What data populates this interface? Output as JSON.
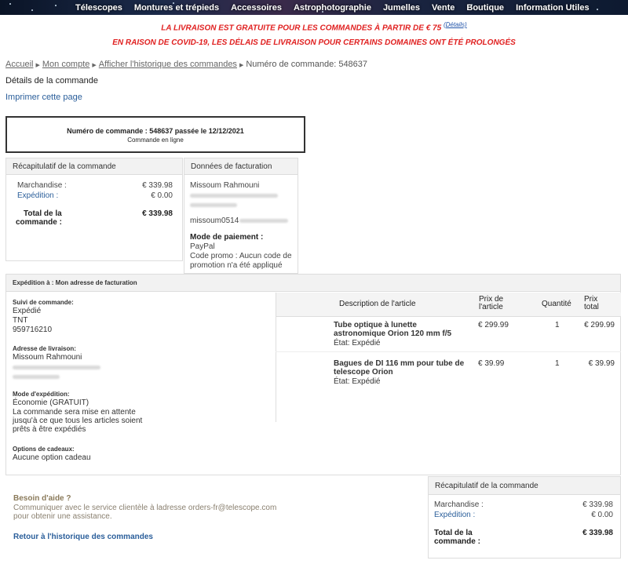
{
  "nav": {
    "items": [
      "Télescopes",
      "Montures et trépieds",
      "Accessoires",
      "Astrophotographie",
      "Jumelles",
      "Vente",
      "Boutique",
      "Information Utiles"
    ]
  },
  "promo": {
    "line1": "LA LIVRAISON EST GRATUITE POUR LES COMMANDES À PARTIR DE € 75",
    "line1_link": "(Détails)",
    "line2": "EN RAISON DE COVID-19, LES DÉLAIS DE LIVRAISON POUR CERTAINS DOMAINES ONT ÉTÉ PROLONGÉS"
  },
  "breadcrumb": {
    "home": "Accueil",
    "account": "Mon compte",
    "history": "Afficher l'historique des commandes",
    "current": "Numéro de commande: 548637"
  },
  "page": {
    "title": "Détails de la commande",
    "print": "Imprimer cette page"
  },
  "order": {
    "header": "Numéro de commande : 548637 passée le 12/12/2021",
    "type": "Commande en ligne"
  },
  "recap": {
    "title": "Récapitulatif de la commande",
    "merch_label": "Marchandise :",
    "merch_value": "€ 339.98",
    "ship_label": "Expédition :",
    "ship_value": "€ 0.00",
    "total_label_1": "Total de la",
    "total_label_2": "commande :",
    "total_value": "€ 339.98"
  },
  "billing": {
    "title": "Données de facturation",
    "name": "Missoum Rahmouni",
    "email_prefix": "missoum0514",
    "payment_title": "Mode de paiement :",
    "payment_method": "PayPal",
    "promo_line1": "Code promo :  Aucun code de",
    "promo_line2": "promotion n'a été appliqué"
  },
  "shipping": {
    "title": "Expédition à : Mon adresse de facturation",
    "tracking_label": "Suivi de commande:",
    "tracking_status": "Expédié",
    "carrier": "TNT",
    "tracking_number": "959716210",
    "address_label": "Adresse de livraison:",
    "address_name": "Missoum Rahmouni",
    "method_label": "Mode d'expédition:",
    "method_value": "Économie (GRATUIT)",
    "method_note_1": "La commande sera mise en attente",
    "method_note_2": "jusqu'à ce que tous les articles soient",
    "method_note_3": "prêts à être expédiés",
    "gift_label": "Options de cadeaux:",
    "gift_value": "Aucune option cadeau"
  },
  "items": {
    "head_desc": "Description de l'article",
    "head_price_1": "Prix de",
    "head_price_2": "l'article",
    "head_qty": "Quantité",
    "head_total_1": "Prix",
    "head_total_2": "total",
    "rows": [
      {
        "name_1": "Tube optique à lunette",
        "name_2": "astronomique Orion 120 mm f/5",
        "status": "État: Expédié",
        "price": "€ 299.99",
        "qty": "1",
        "total": "€ 299.99"
      },
      {
        "name_1": "Bagues de DI 116 mm pour tube de",
        "name_2": "telescope Orion",
        "status": "État: Expédié",
        "price": "€ 39.99",
        "qty": "1",
        "total": "€ 39.99"
      }
    ]
  },
  "recap2": {
    "title": "Récapitulatif de la commande",
    "merch_label": "Marchandise :",
    "merch_value": "€ 339.98",
    "ship_label": "Expédition :",
    "ship_value": "€ 0.00",
    "total_label_1": "Total de la",
    "total_label_2": "commande :",
    "total_value": "€ 339.98"
  },
  "help": {
    "title": "Besoin d'aide ?",
    "line1": "Communiquer avec le service clientèle à ladresse orders-fr@telescope.com",
    "line2": "pour obtenir une assistance.",
    "back": "Retour à l'historique des commandes"
  }
}
